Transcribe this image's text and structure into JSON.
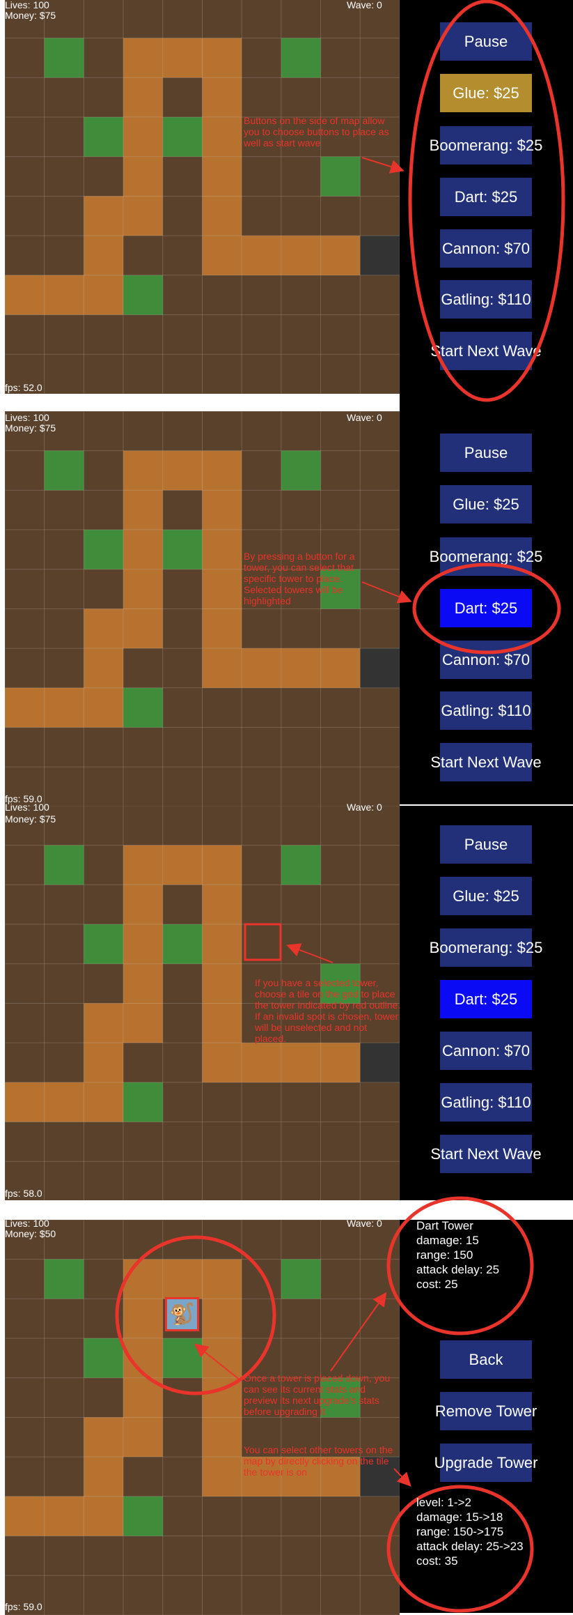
{
  "panel1": {
    "hud": {
      "lives": "Lives: 100",
      "money": "Money: $75",
      "wave": "Wave: 0"
    },
    "fps": "fps: 52.0",
    "buttons": [
      "Pause",
      "Glue: $25",
      "Boomerang: $25",
      "Dart: $25",
      "Cannon: $70",
      "Gatling: $110",
      "Start Next Wave"
    ],
    "note": "Buttons on the side of map allow you to choose buttons to place as well as start wave"
  },
  "panel2": {
    "hud": {
      "lives": "Lives: 100",
      "money": "Money: $75",
      "wave": "Wave: 0"
    },
    "fps": "fps: 59.0",
    "buttons": [
      "Pause",
      "Glue: $25",
      "Boomerang: $25",
      "Dart: $25",
      "Cannon: $70",
      "Gatling: $110",
      "Start Next Wave"
    ],
    "note": "By pressing a button for a tower, you can select that specific tower to place. Selected towers will be highlighted"
  },
  "panel3": {
    "hud": {
      "lives": "Lives: 100",
      "money": "Money: $75",
      "wave": "Wave: 0"
    },
    "fps": "fps: 58.0",
    "buttons": [
      "Pause",
      "Glue: $25",
      "Boomerang: $25",
      "Dart: $25",
      "Cannon: $70",
      "Gatling: $110",
      "Start Next Wave"
    ],
    "note": "If you have a selected tower, choose a tile on the grid to place the tower indicated by red outline. If an invalid spot is chosen, tower will be unselected and not placed."
  },
  "panel4": {
    "hud": {
      "lives": "Lives: 100",
      "money": "Money: $50",
      "wave": "Wave: 0"
    },
    "fps": "fps: 59.0",
    "buttons": [
      "Back",
      "Remove Tower",
      "Upgrade Tower"
    ],
    "note1": "Once a tower is placed down, you can see its current stats and  preview its next upgrade's stats before upgrading it",
    "note2": "You can select other towers on the map by directly clicking on the tile the tower is on",
    "stats": [
      "Dart Tower",
      "damage: 15",
      "range: 150",
      "attack delay: 25",
      "cost: 25"
    ],
    "upgrade": [
      "level: 1->2",
      "damage: 15->18",
      "range: 150->175",
      "attack delay: 25->23",
      "cost: 35"
    ]
  },
  "colors": {
    "grass": "#5a412b",
    "path": "#b7722f",
    "green": "#3f8d3a",
    "exit": "#333333",
    "button": "#22307a",
    "button_glue": "#b48d2e",
    "button_selected": "#0a0af5",
    "annotation": "#e8342a"
  },
  "icons": {
    "tower": "monkey-icon"
  }
}
